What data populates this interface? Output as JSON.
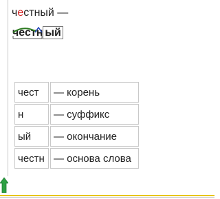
{
  "word": {
    "chars": [
      "ч",
      "е",
      "с",
      "т",
      "н",
      "ы",
      "й"
    ],
    "suffix": " —",
    "highlight_color": "#d21f1f"
  },
  "analysis": {
    "root": "честн",
    "root_first": "честн",
    "suffix_letter": "н",
    "ending": "ый",
    "mark_color": "#2b7a1f",
    "suffix_mark_color": "#1a3fb8"
  },
  "table": {
    "rows": [
      {
        "part": "чест",
        "desc": "— корень"
      },
      {
        "part": "н",
        "desc": "— суффикс"
      },
      {
        "part": "ый",
        "desc": "— окончание"
      },
      {
        "part": "честн",
        "desc": "— основа слова"
      }
    ]
  },
  "corner": {
    "icon": "green-up-arrow-icon",
    "color": "#2ea043"
  }
}
